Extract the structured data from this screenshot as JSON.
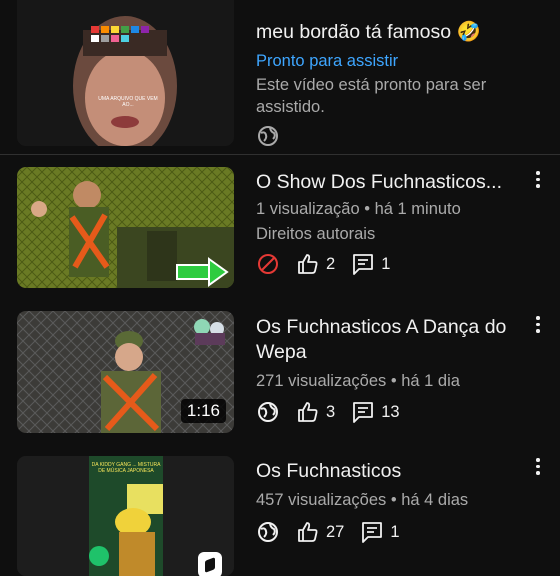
{
  "videos": [
    {
      "title": "meu bordão tá famoso 🤣",
      "status_link": "Pronto para assistir",
      "status_desc": "Este vídeo está pronto para ser assistido.",
      "visibility_icon": "globe-icon",
      "thumb_caption": "UMA ARQUIVO QUE VEM AO..."
    },
    {
      "title": "O Show Dos Fuchnasticos...",
      "meta": "1 visualização • há 1 minuto",
      "notice": "Direitos autorais",
      "visibility_icon": "blocked-icon",
      "likes": "2",
      "comments": "1"
    },
    {
      "title": "Os Fuchnasticos A Dança do Wepa",
      "meta": "271 visualizações • há 1 dia",
      "duration": "1:16",
      "visibility_icon": "globe-icon",
      "likes": "3",
      "comments": "13"
    },
    {
      "title": "Os Fuchnasticos",
      "meta": "457 visualizações • há 4 dias",
      "visibility_icon": "globe-icon",
      "likes": "27",
      "comments": "1",
      "thumb_caption": "DA KIDDY GANG ... MISTURA DE MÚSICA JAPONESA"
    }
  ],
  "colors": {
    "background": "#0f0f0f",
    "link": "#3ea6ff",
    "secondary_text": "#aaaaaa",
    "blocked": "#e53935"
  }
}
